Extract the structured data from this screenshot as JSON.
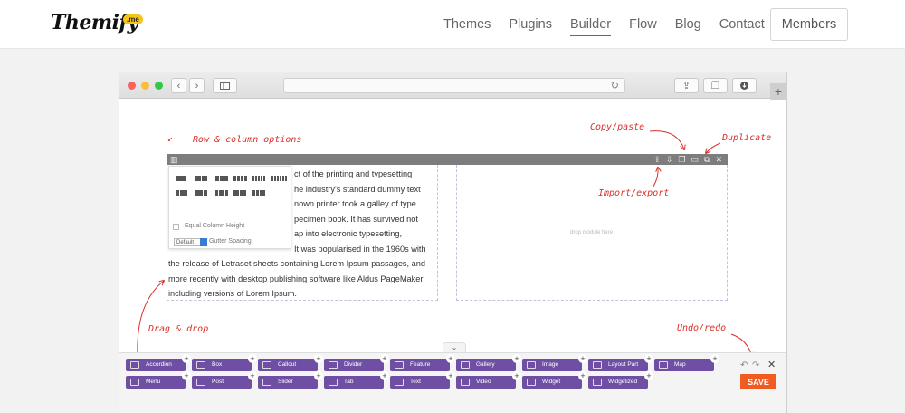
{
  "site": {
    "logo": "Themify",
    "logo_badge": ".me",
    "nav": [
      "Themes",
      "Plugins",
      "Builder",
      "Flow",
      "Blog",
      "Contact"
    ],
    "active_nav": "Builder",
    "members_label": "Members"
  },
  "browser": {
    "dot_colors": [
      "#fc605c",
      "#fdbc40",
      "#34c84a"
    ],
    "back_icon": "chevron-left-icon",
    "forward_icon": "chevron-right-icon",
    "sidebar_icon": "sidebar-icon",
    "share_icon": "share-icon",
    "tabs_icon": "tabs-icon",
    "download_icon": "download-icon",
    "reload_icon": "reload-icon",
    "newtab_label": "+"
  },
  "builder": {
    "lorem_lines": [
      "ct of the printing and typesetting",
      "he industry's standard dummy text",
      "nown printer took a galley of type",
      "pecimen book. It has survived not",
      "ap into electronic typesetting,",
      "It was popularised in the 1960s with",
      "the release of Letraset sheets containing Lorem Ipsum passages, and",
      "more recently with desktop publishing software like Aldus PageMaker",
      "including versions of Lorem Ipsum."
    ],
    "equal_height_label": "Equal Column Height",
    "gutter_value": "Default",
    "gutter_label": "Gutter Spacing",
    "drop_hint": "drop module here"
  },
  "annotations": {
    "row_options": "Row & column options",
    "copy_paste": "Copy/paste",
    "duplicate": "Duplicate",
    "import_export": "Import/export",
    "drag_drop": "Drag & drop",
    "undo_redo": "Undo/redo"
  },
  "modules": {
    "row1": [
      "Accordion",
      "Box",
      "Callout",
      "Divider",
      "Feature",
      "Gallery",
      "Image",
      "Layout Part",
      "Map"
    ],
    "row2": [
      "Menu",
      "Post",
      "Slider",
      "Tab",
      "Text",
      "Video",
      "Widget",
      "Widgetized"
    ]
  },
  "panel": {
    "undo": "↶",
    "redo": "↷",
    "close": "✕",
    "save_label": "SAVE",
    "save_color": "#f05b22",
    "module_color": "#6e4fa3"
  }
}
